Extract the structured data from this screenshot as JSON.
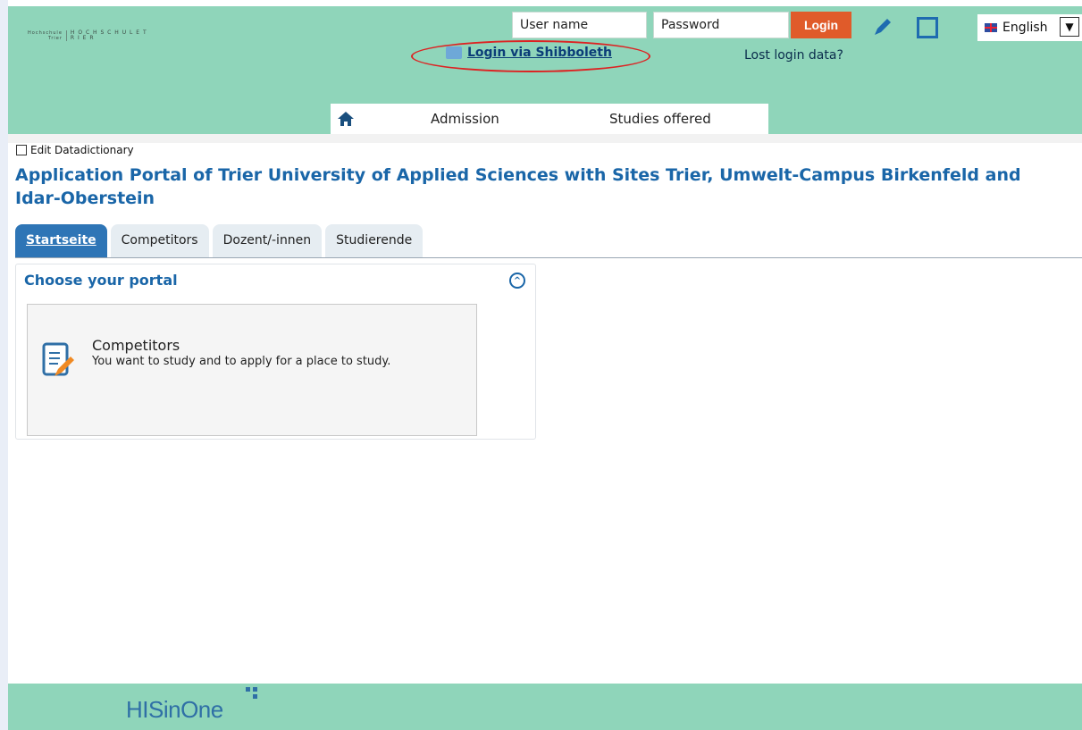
{
  "header": {
    "logo": {
      "left_text": "Hochschule Trier",
      "right_text": "H O C H S C H U L E T R I E R"
    },
    "username_placeholder": "User name",
    "password_placeholder": "Password",
    "login_label": "Login",
    "shibboleth_label": "Login via Shibboleth",
    "lost_login_label": "Lost login data?",
    "language": "English"
  },
  "nav": {
    "items": [
      {
        "label": "Admission"
      },
      {
        "label": "Studies offered"
      }
    ]
  },
  "datadictionary_label": "Edit Datadictionary",
  "page_title": "Application Portal of Trier University of Applied Sciences with Sites Trier, Umwelt-Campus Birkenfeld and Idar-Oberstein",
  "tabs": [
    {
      "label": "Startseite",
      "active": true
    },
    {
      "label": "Competitors",
      "active": false
    },
    {
      "label": "Dozent/-innen",
      "active": false
    },
    {
      "label": "Studierende",
      "active": false
    }
  ],
  "panel": {
    "title": "Choose your portal",
    "card_title": "Competitors",
    "card_desc": "You want to study and to apply for a place to study."
  },
  "footer": {
    "brand": "HISinOne"
  },
  "colors": {
    "header_bg": "#8fd5ba",
    "accent": "#1a66a8",
    "login_btn": "#e05b2a"
  }
}
